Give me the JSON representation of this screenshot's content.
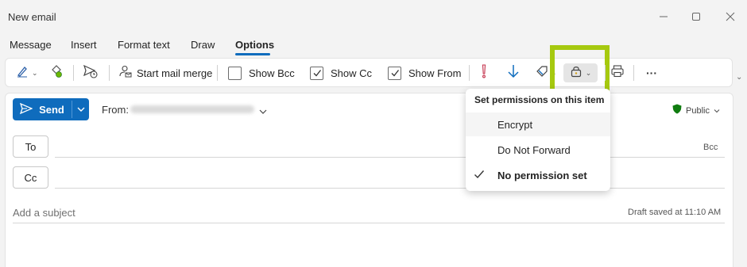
{
  "window": {
    "title": "New email"
  },
  "tabs": [
    {
      "label": "Message"
    },
    {
      "label": "Insert"
    },
    {
      "label": "Format text"
    },
    {
      "label": "Draw"
    },
    {
      "label": "Options"
    }
  ],
  "active_tab": "Options",
  "ribbon": {
    "mail_merge_label": "Start mail merge",
    "show_bcc": {
      "label": "Show Bcc",
      "checked": false
    },
    "show_cc": {
      "label": "Show Cc",
      "checked": true
    },
    "show_from": {
      "label": "Show From",
      "checked": true
    },
    "more": "···"
  },
  "compose": {
    "send_label": "Send",
    "from_label": "From:",
    "to_label": "To",
    "cc_label": "Cc",
    "bcc_label": "Bcc",
    "subject_placeholder": "Add a subject",
    "draft_status": "Draft saved at 11:10 AM",
    "sensitivity_label": "Public"
  },
  "permissions_menu": {
    "title": "Set permissions on this item",
    "items": [
      {
        "label": "Encrypt",
        "checked": false
      },
      {
        "label": "Do Not Forward",
        "checked": false
      },
      {
        "label": "No permission set",
        "checked": true
      }
    ]
  },
  "colors": {
    "accent": "#0f6cbd",
    "highlight": "#a6c90f",
    "shield_green": "#107c10",
    "importance_red": "#c4314b"
  }
}
